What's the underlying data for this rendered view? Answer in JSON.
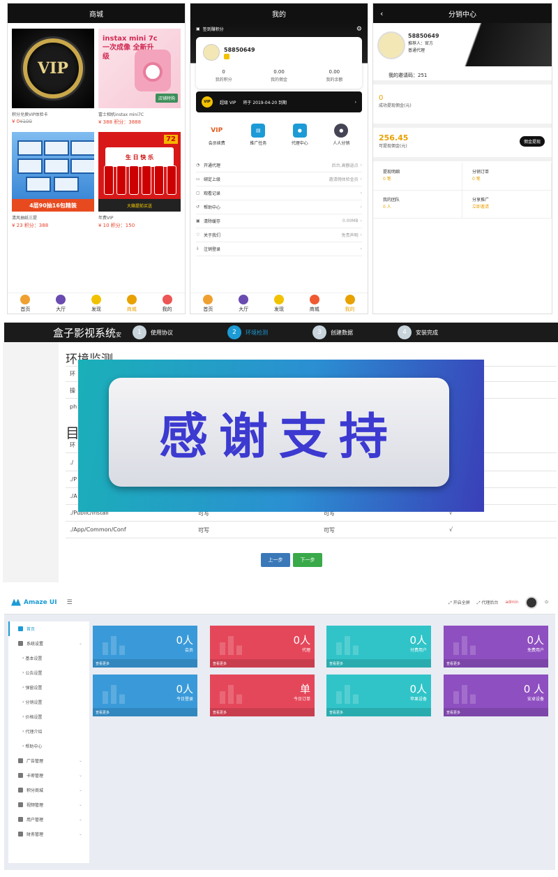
{
  "phone_shop": {
    "title": "商城",
    "items": [
      {
        "name": "积分兑换VIP体验卡",
        "price": "¥ 0",
        "old_price": "¥100",
        "img_text": "VIP"
      },
      {
        "name": "富士相机instax mini7C",
        "price": "¥ 388 积分：3888",
        "img_text": "instax mini 7c",
        "img_sub": "一次成像 全新升级",
        "img_badge": "店铺特购"
      },
      {
        "name": "清风抽纸三提",
        "price": "¥ 23 积分：388",
        "img_banner": "4层90抽16包精装"
      },
      {
        "name": "年费VIP",
        "price": "¥ 10 积分：150",
        "img_sign": "生 日 快 乐",
        "img_tag": "72",
        "img_banner": "大箱提前买送"
      }
    ],
    "tabs": [
      "首页",
      "大厅",
      "发现",
      "商城",
      "我的"
    ],
    "active_tab": "商城"
  },
  "phone_my": {
    "title": "我的",
    "signin": "签到赚积分",
    "username": "58850649",
    "stats": [
      {
        "value": "0",
        "label": "我的积分"
      },
      {
        "value": "0.00",
        "label": "我的佣金"
      },
      {
        "value": "0.00",
        "label": "我的余额"
      }
    ],
    "vip_label": "超级 VIP",
    "vip_expiry": "将于 2019-04-20 到期",
    "vip_icon": "VIP",
    "quick": [
      {
        "label": "会员续费",
        "icon": "VIP"
      },
      {
        "label": "推广任务",
        "icon": "box"
      },
      {
        "label": "代理中心",
        "icon": "user-gear"
      },
      {
        "label": "人人分销",
        "icon": "user"
      }
    ],
    "menu": [
      {
        "label": "开通代理",
        "value": "后台,高额返点"
      },
      {
        "label": "绑定上级",
        "value": "邀请佣体验金员"
      },
      {
        "label": "观看记录",
        "value": ""
      },
      {
        "label": "帮助中心",
        "value": ""
      },
      {
        "label": "清除缓存",
        "value": "0.00MB"
      },
      {
        "label": "关于我们",
        "value": "免责声明"
      },
      {
        "label": "注销登录",
        "value": ""
      }
    ],
    "tabs": [
      "首页",
      "大厅",
      "发现",
      "商城",
      "我的"
    ],
    "active_tab": "我的"
  },
  "phone_dist": {
    "title": "分销中心",
    "username": "58850649",
    "referrer": "推荐人：官方",
    "role": "普通代理",
    "invite_code": "我的邀请码：251",
    "success_amount": "0",
    "success_label": "成功提现佣金(元)",
    "avail_amount": "256.45",
    "avail_label": "可提现佣金(元)",
    "withdraw_btn": "佣金提现",
    "grid": [
      {
        "label": "提现明细",
        "sub": "0 笔"
      },
      {
        "label": "分销订单",
        "sub": "0 笔"
      },
      {
        "label": "我的团队",
        "sub": "0 人"
      },
      {
        "label": "分享推广",
        "sub": "立即邀请"
      }
    ]
  },
  "installer": {
    "brand": "盒子影视系统",
    "brand_suffix": "安",
    "steps": [
      {
        "num": "1",
        "label": "使用协议"
      },
      {
        "num": "2",
        "label": "环境检测"
      },
      {
        "num": "3",
        "label": "创建数据"
      },
      {
        "num": "4",
        "label": "安装完成"
      }
    ],
    "active_step": "2",
    "env_title": "环境监测",
    "env_rows": [
      "环",
      "操",
      "ph"
    ],
    "dir_title": "目",
    "dir_rows": [
      {
        "path": "环",
        "a": "",
        "b": "",
        "c": ""
      },
      {
        "path": "./",
        "a": "",
        "b": "",
        "c": ""
      },
      {
        "path": "./P",
        "a": "",
        "b": "",
        "c": ""
      },
      {
        "path": "./A",
        "a": "",
        "b": "",
        "c": ""
      },
      {
        "path": "./Public/Install",
        "a": "可写",
        "b": "可写",
        "c": "√"
      },
      {
        "path": "./App/Common/Conf",
        "a": "可写",
        "b": "可写",
        "c": "√"
      }
    ],
    "prev_btn": "上一步",
    "next_btn": "下一步",
    "overlay_text": "感谢支持"
  },
  "admin": {
    "logo": "Amaze UI",
    "top_links": [
      "开启全屏",
      "代理后台"
    ],
    "user": "admin",
    "sidebar": [
      {
        "label": "首页",
        "type": "home"
      },
      {
        "label": "系统设置",
        "type": "group"
      },
      {
        "label": "基本设置",
        "type": "sub"
      },
      {
        "label": "公告设置",
        "type": "sub"
      },
      {
        "label": "弹窗设置",
        "type": "sub"
      },
      {
        "label": "分销设置",
        "type": "sub"
      },
      {
        "label": "价格设置",
        "type": "sub"
      },
      {
        "label": "代理介绍",
        "type": "sub"
      },
      {
        "label": "帮助中心",
        "type": "sub"
      },
      {
        "label": "广告管理",
        "type": "group"
      },
      {
        "label": "卡密管理",
        "type": "group"
      },
      {
        "label": "积分商城",
        "type": "group"
      },
      {
        "label": "视频管理",
        "type": "group"
      },
      {
        "label": "用户管理",
        "type": "group"
      },
      {
        "label": "财务管理",
        "type": "group"
      }
    ],
    "cards": [
      {
        "value": "0人",
        "label": "会员",
        "more": "查看更多",
        "color": "#3a9ad9"
      },
      {
        "value": "0人",
        "label": "代理",
        "more": "查看更多",
        "color": "#e5475a"
      },
      {
        "value": "0人",
        "label": "付费用户",
        "more": "查看更多",
        "color": "#30c4c8"
      },
      {
        "value": "0人",
        "label": "免费用户",
        "more": "查看更多",
        "color": "#8e4fc0"
      },
      {
        "value": "0人",
        "label": "今日登录",
        "more": "查看更多",
        "color": "#3a9ad9"
      },
      {
        "value": "单",
        "label": "今日订单",
        "more": "查看更多",
        "color": "#e5475a"
      },
      {
        "value": "0人",
        "label": "苹果设备",
        "more": "查看更多",
        "color": "#30c4c8"
      },
      {
        "value": "0 人",
        "label": "安卓设备",
        "more": "查看更多",
        "color": "#8e4fc0"
      }
    ]
  }
}
